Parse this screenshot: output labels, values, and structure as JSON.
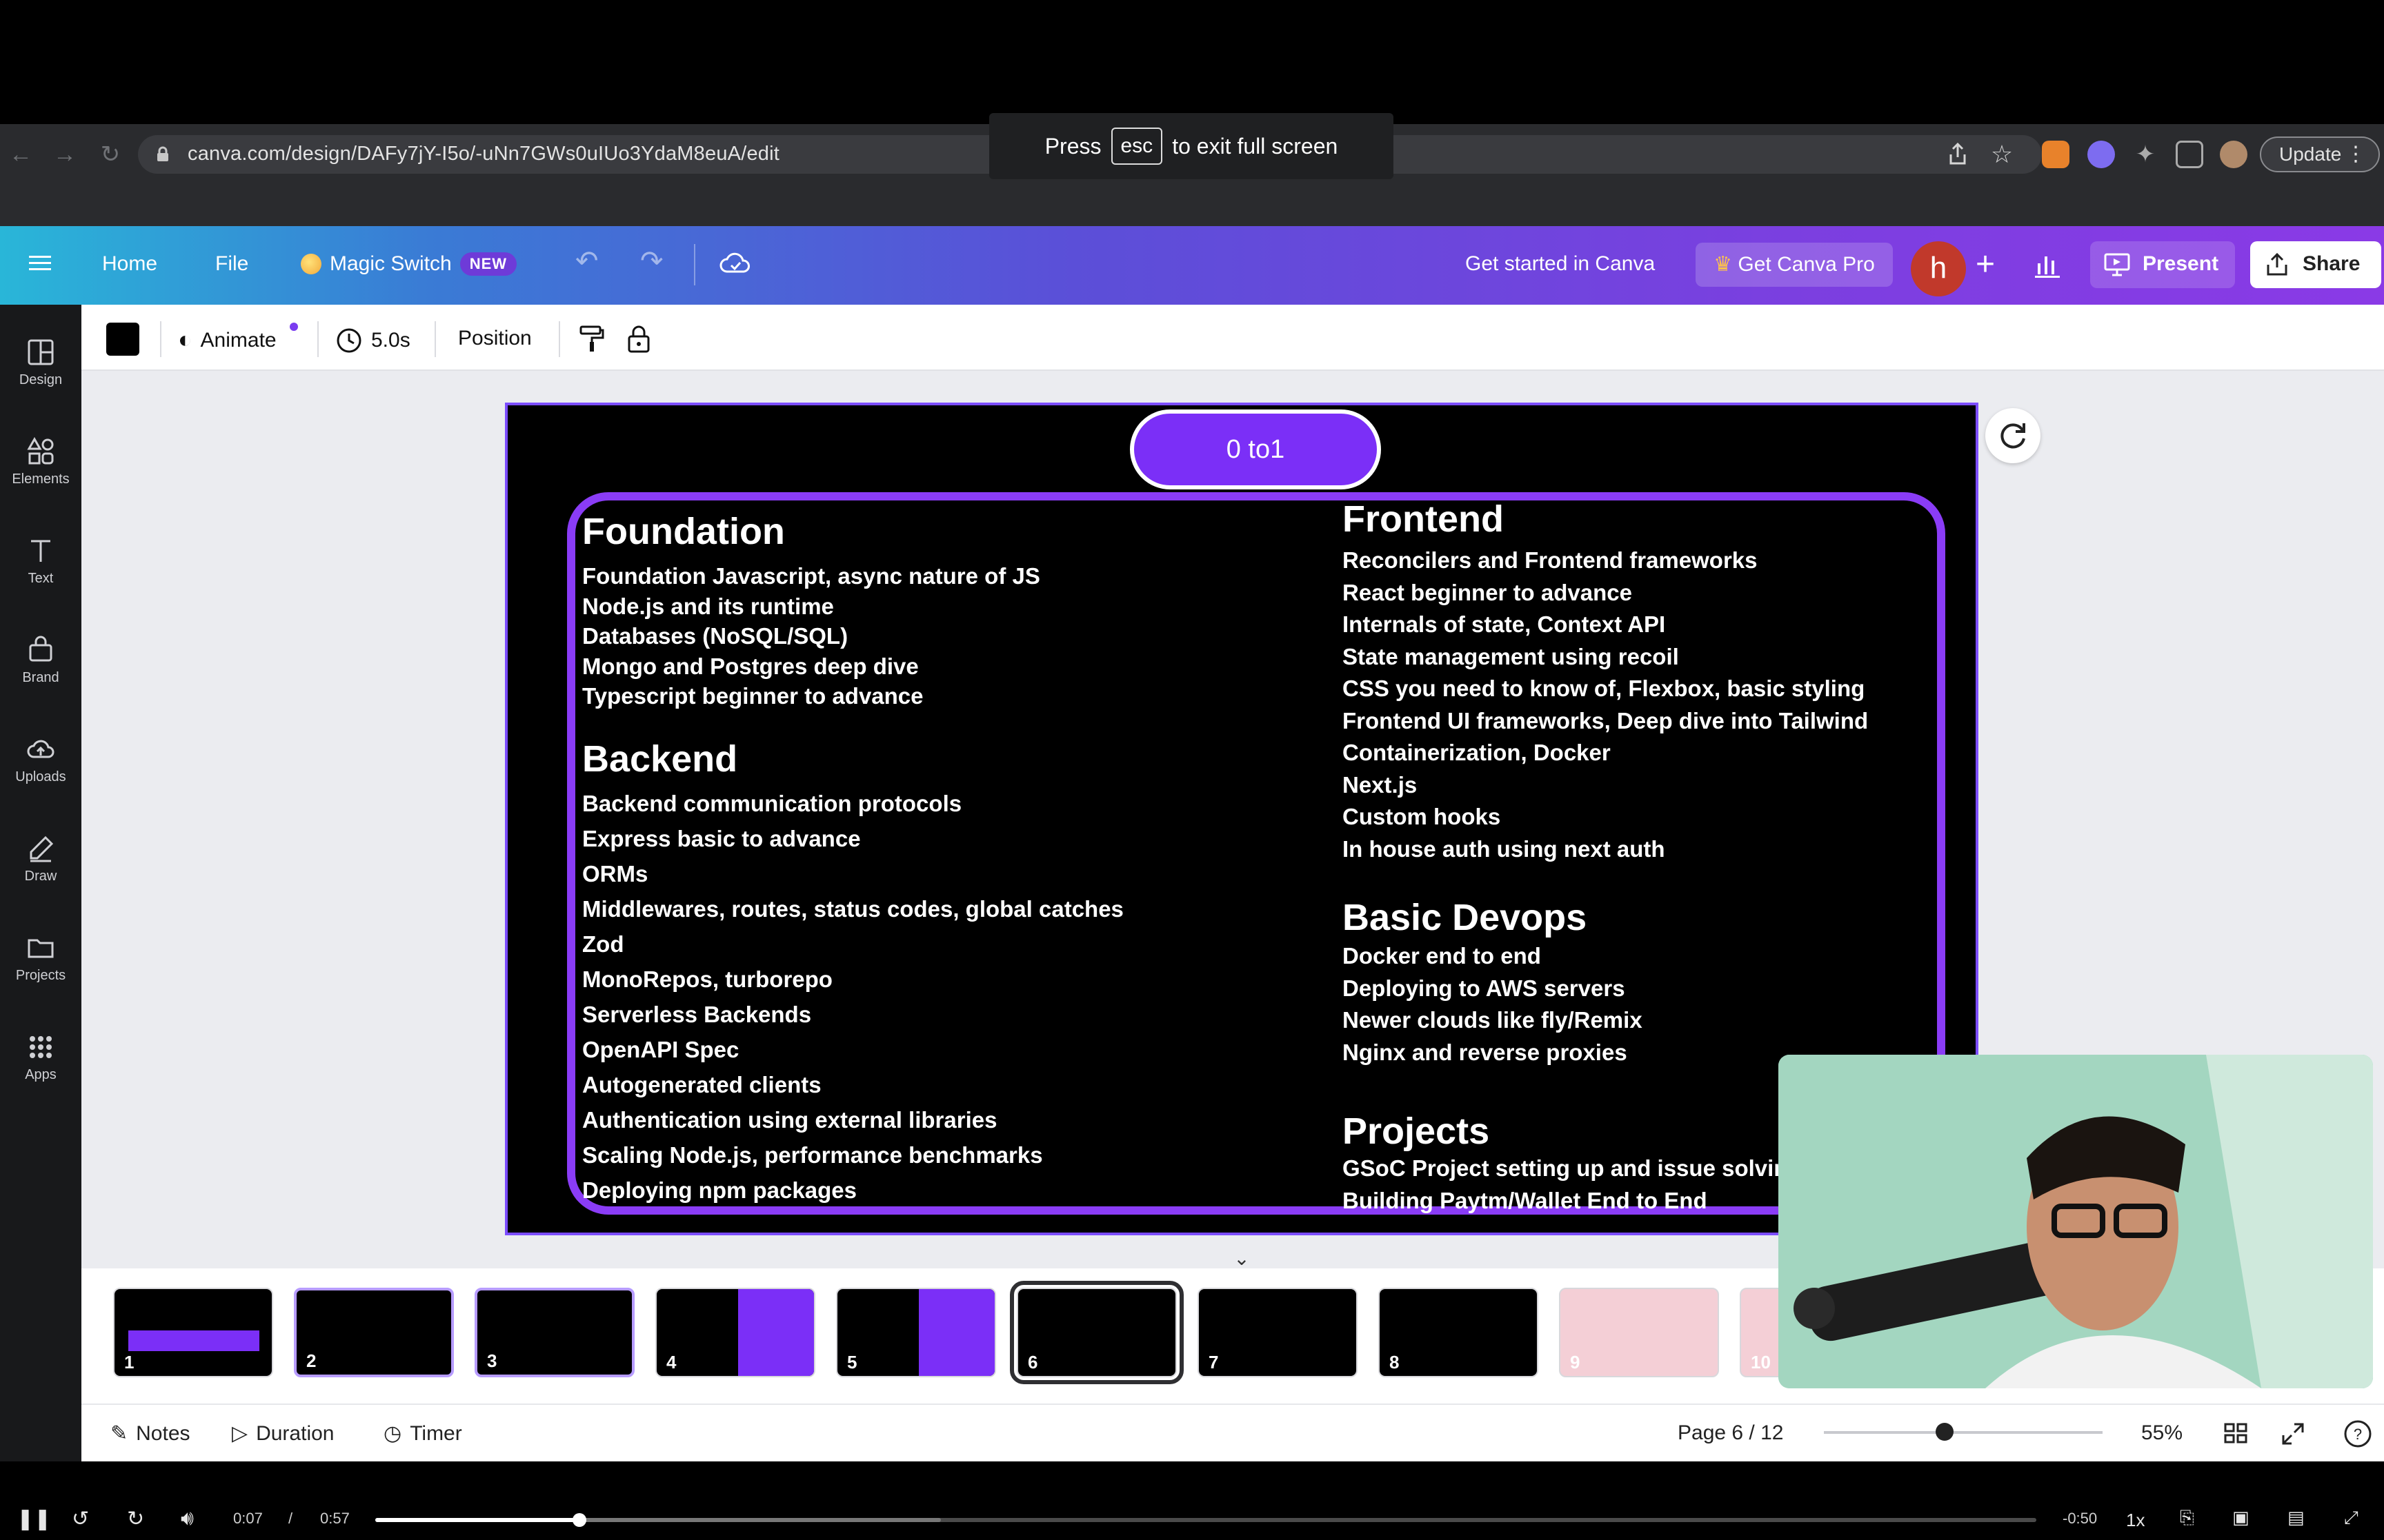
{
  "browser": {
    "url": "canva.com/design/DAFy7jY-I5o/-uNn7GWs0uIUo3YdaM8euA/edit",
    "fullscreen_notice": {
      "before": "Press",
      "key": "esc",
      "after": "to exit full screen"
    },
    "update_label": "Update"
  },
  "header": {
    "home": "Home",
    "file": "File",
    "magic_switch": "Magic Switch",
    "new_badge": "NEW",
    "get_started": "Get started in Canva",
    "canva_pro": "Get Canva Pro",
    "avatar_initial": "h",
    "present": "Present",
    "share": "Share"
  },
  "sidebar": {
    "items": [
      {
        "label": "Design",
        "icon": "layout-icon"
      },
      {
        "label": "Elements",
        "icon": "shapes-icon"
      },
      {
        "label": "Text",
        "icon": "text-icon"
      },
      {
        "label": "Brand",
        "icon": "brand-icon"
      },
      {
        "label": "Uploads",
        "icon": "cloud-upload-icon"
      },
      {
        "label": "Draw",
        "icon": "pen-icon"
      },
      {
        "label": "Projects",
        "icon": "folder-icon"
      },
      {
        "label": "Apps",
        "icon": "grid-icon"
      }
    ]
  },
  "toolbar": {
    "animate": "Animate",
    "duration": "5.0s",
    "position": "Position"
  },
  "slide": {
    "pill": "0 to1",
    "foundation_title": "Foundation",
    "foundation_items": [
      "Foundation Javascript, async nature of JS",
      "Node.js and its runtime",
      "Databases (NoSQL/SQL)",
      "Mongo and Postgres deep dive",
      "Typescript beginner to advance"
    ],
    "backend_title": "Backend",
    "backend_items": [
      "Backend communication protocols",
      "Express basic to advance",
      "ORMs",
      "Middlewares, routes, status codes, global catches",
      "Zod",
      "MonoRepos, turborepo",
      "Serverless Backends",
      "OpenAPI Spec",
      "Autogenerated clients",
      "Authentication using external libraries",
      "Scaling Node.js, performance benchmarks",
      "Deploying npm packages"
    ],
    "frontend_title": "Frontend",
    "frontend_items": [
      "Reconcilers and Frontend frameworks",
      "React beginner to advance",
      "Internals of state, Context API",
      "State management using recoil",
      "CSS you need to know of, Flexbox, basic styling",
      "Frontend UI frameworks, Deep dive into Tailwind",
      "Containerization, Docker",
      "Next.js",
      "Custom hooks",
      "In house auth using next auth"
    ],
    "devops_title": "Basic Devops",
    "devops_items": [
      "Docker end to end",
      "Deploying to AWS servers",
      "Newer clouds like fly/Remix",
      "Nginx and reverse proxies"
    ],
    "projects_title": "Projects",
    "projects_items": [
      "GSoC Project setting up and issue solving",
      "Building Paytm/Wallet End to End"
    ]
  },
  "thumbnails": [
    {
      "num": "1"
    },
    {
      "num": "2"
    },
    {
      "num": "3"
    },
    {
      "num": "4"
    },
    {
      "num": "5"
    },
    {
      "num": "6",
      "selected": true
    },
    {
      "num": "7"
    },
    {
      "num": "8"
    },
    {
      "num": "9"
    },
    {
      "num": "10"
    }
  ],
  "footer": {
    "notes": "Notes",
    "duration": "Duration",
    "timer": "Timer",
    "page": "Page 6 / 12",
    "zoom": "55%"
  },
  "player": {
    "current": "0:07",
    "separator": "/",
    "total": "0:57",
    "remaining": "-0:50",
    "speed": "1x",
    "progress_fraction": 0.123
  }
}
